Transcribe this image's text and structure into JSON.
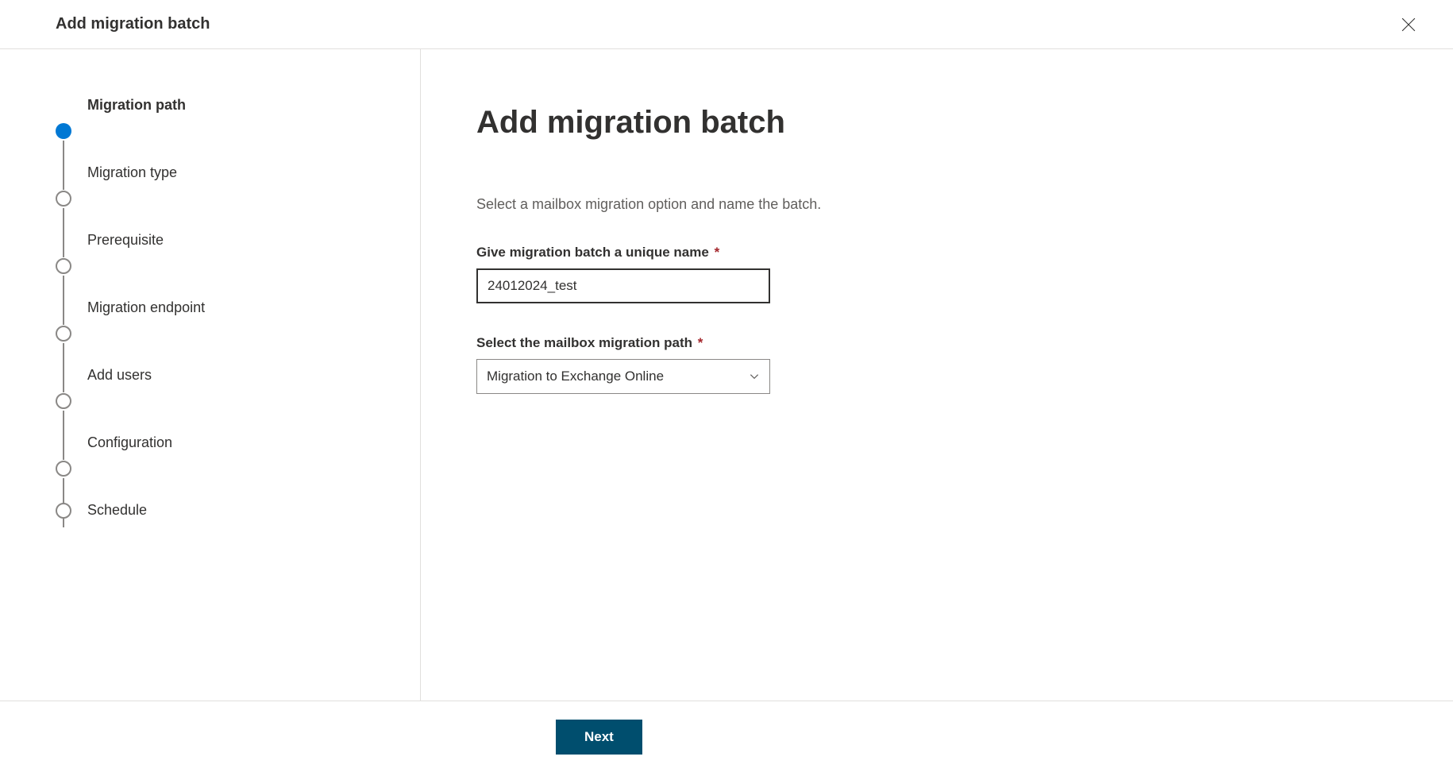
{
  "header": {
    "title": "Add migration batch"
  },
  "steps": [
    {
      "label": "Migration path",
      "active": true
    },
    {
      "label": "Migration type",
      "active": false
    },
    {
      "label": "Prerequisite",
      "active": false
    },
    {
      "label": "Migration endpoint",
      "active": false
    },
    {
      "label": "Add users",
      "active": false
    },
    {
      "label": "Configuration",
      "active": false
    },
    {
      "label": "Schedule",
      "active": false
    }
  ],
  "main": {
    "title": "Add migration batch",
    "description": "Select a mailbox migration option and name the batch.",
    "name_label": "Give migration batch a unique name",
    "name_value": "24012024_test",
    "path_label": "Select the mailbox migration path",
    "path_value": "Migration to Exchange Online"
  },
  "footer": {
    "next_label": "Next"
  }
}
